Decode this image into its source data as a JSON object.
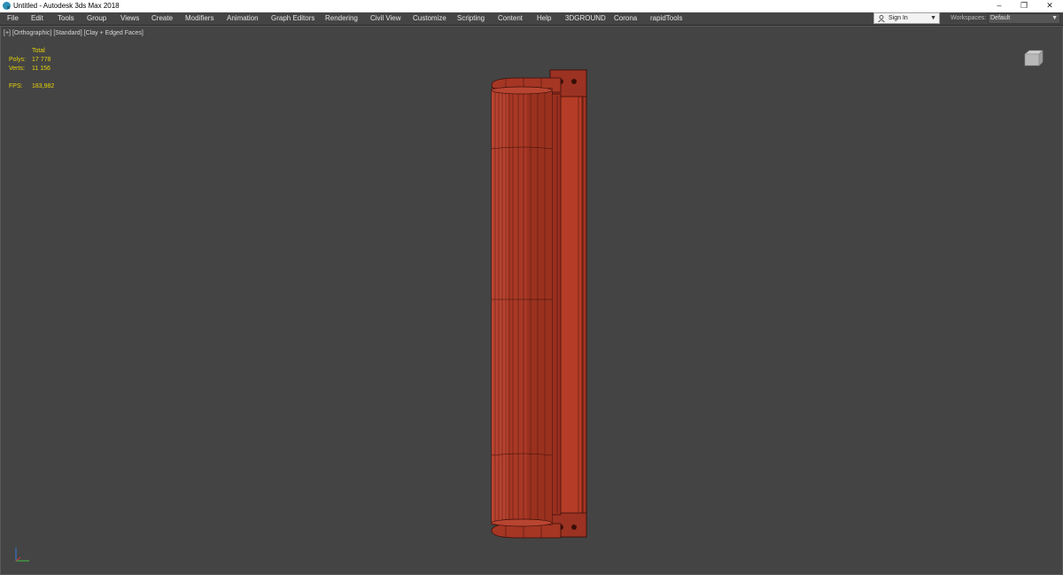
{
  "window": {
    "title": "Untitled - Autodesk 3ds Max 2018"
  },
  "menubar": {
    "items": [
      {
        "label": "File"
      },
      {
        "label": "Edit"
      },
      {
        "label": "Tools"
      },
      {
        "label": "Group"
      },
      {
        "label": "Views"
      },
      {
        "label": "Create"
      },
      {
        "label": "Modifiers"
      },
      {
        "label": "Animation"
      },
      {
        "label": "Graph Editors"
      },
      {
        "label": "Rendering"
      },
      {
        "label": "Civil View"
      },
      {
        "label": "Customize"
      },
      {
        "label": "Scripting"
      },
      {
        "label": "Content"
      },
      {
        "label": "Help"
      },
      {
        "label": "3DGROUND"
      },
      {
        "label": "Corona"
      },
      {
        "label": "rapidTools"
      }
    ]
  },
  "account": {
    "signin_label": "Sign In"
  },
  "workspaces": {
    "label": "Workspaces:",
    "value": "Default"
  },
  "viewport": {
    "labels": [
      "[+]",
      "[Orthographic]",
      "[Standard]",
      "[Clay + Edged Faces]"
    ],
    "stats": {
      "total_label": "Total",
      "polys_label": "Polys:",
      "polys_value": "17 778",
      "verts_label": "Verts:",
      "verts_value": "11 156",
      "fps_label": "FPS:",
      "fps_value": "183,982"
    }
  },
  "colors": {
    "viewport_bg": "#444444",
    "model_fill": "#b03a26",
    "wire": "#3a0e08",
    "stats_text": "#e6d20a"
  },
  "icons": [
    "app-icon",
    "minimize-icon",
    "restore-icon",
    "close-icon",
    "user-icon",
    "chevron-down-icon",
    "viewcube-icon",
    "axis-tripod-icon"
  ]
}
